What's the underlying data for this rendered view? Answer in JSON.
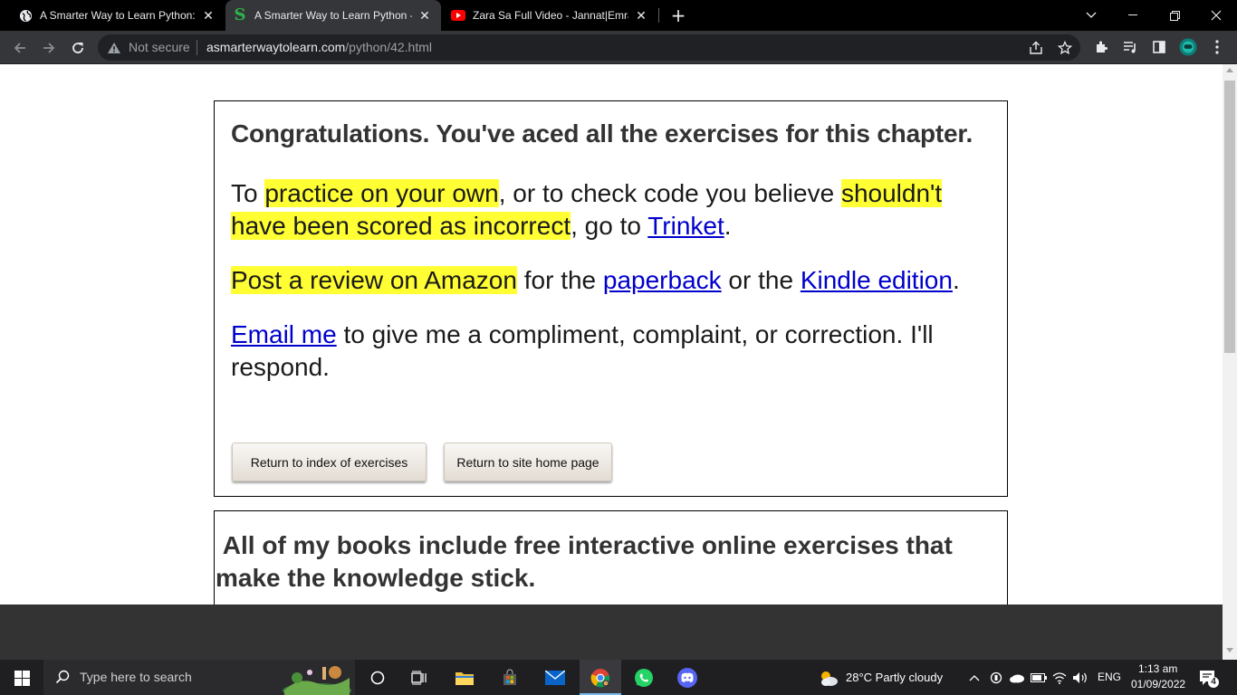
{
  "browser": {
    "tabs": [
      {
        "title": "A Smarter Way to Learn Python: l",
        "favicon": "globe-icon",
        "active": false
      },
      {
        "title": "A Smarter Way to Learn Python -",
        "favicon": "s-logo-icon",
        "active": true
      },
      {
        "title": "Zara Sa Full Video - Jannat|Emraa",
        "favicon": "youtube-icon",
        "active": false
      }
    ],
    "security_label": "Not secure",
    "url_host": "asmarterwaytolearn.com",
    "url_path": "/python/42.html"
  },
  "page": {
    "headline": "Congratulations. You've aced all the exercises for this chapter.",
    "p1": {
      "t1": "To ",
      "h1": "practice on your own",
      "t2": ", or to check code you believe ",
      "h2": "shouldn't have been scored as incorrect",
      "t3": ", go to ",
      "link": "Trinket",
      "t4": "."
    },
    "p2": {
      "h1": "Post a review on Amazon",
      "t1": " for the ",
      "link1": "paperback",
      "t2": " or the ",
      "link2": "Kindle edition",
      "t3": "."
    },
    "p3": {
      "link": "Email me",
      "t1": " to give me a compliment, complaint, or correction. I'll respond."
    },
    "buttons": {
      "index": "Return to index of exercises",
      "home": "Return to site home page"
    },
    "card2_headline": " All of my books include free interactive online exercises that make the knowledge stick."
  },
  "taskbar": {
    "search_placeholder": "Type here to search",
    "weather": "28°C  Partly cloudy",
    "language": "ENG",
    "time": "1:13 am",
    "date": "01/09/2022",
    "notification_count": "4"
  },
  "colors": {
    "highlight": "#ffff33",
    "link": "#0000cc",
    "chrome_dark": "#35363a"
  }
}
